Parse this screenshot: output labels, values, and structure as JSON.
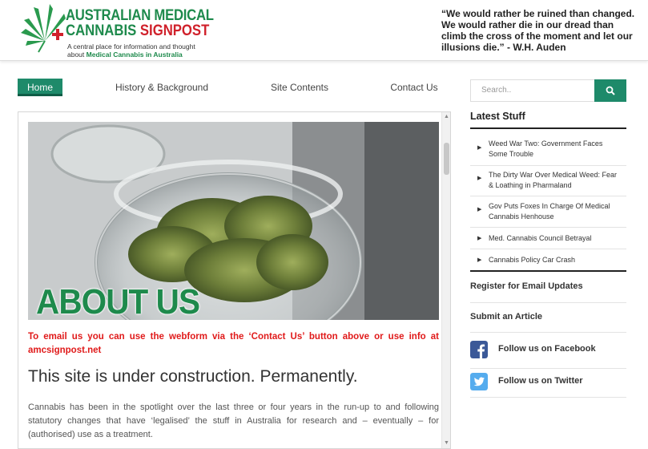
{
  "header": {
    "logo_line1": "AUSTRALIAN MEDICAL",
    "logo_line2_green": "CANNABIS",
    "logo_line2_red": "SIGNPOST",
    "tagline_line1": "A central place for information and thought",
    "tagline_line2_prefix": "about",
    "tagline_line2_bold": "Medical Cannabis in Australia",
    "quote": "“We would rather be ruined than changed. We would rather die in our dread than climb the cross of the moment and let our illusions die.” - W.H. Auden"
  },
  "nav": {
    "items": [
      {
        "label": "Home",
        "active": true
      },
      {
        "label": "History & Background",
        "active": false
      },
      {
        "label": "Site Contents",
        "active": false
      },
      {
        "label": "Contact Us",
        "active": false
      }
    ]
  },
  "main": {
    "hero_title": "ABOUT US",
    "email_note": "To email us you can use the webform via the ‘Contact Us’ button above or use info at amcsignpost.net",
    "headline": "This site is under construction. Permanently.",
    "paragraph": "Cannabis has been in the spotlight over the last three or four years in the run-up to and following statutory changes that have ‘legalised’ the stuff in Australia for research and – eventually – for (authorised) use as a treatment."
  },
  "sidebar": {
    "search_placeholder": "Search..",
    "latest_heading": "Latest Stuff",
    "posts": [
      "Weed War Two: Government Faces Some Trouble",
      "The Dirty War Over Medical Weed: Fear & Loathing in Pharmaland",
      "Gov Puts Foxes In Charge Of Medical Cannabis Henhouse",
      "Med. Cannabis Council Betrayal",
      "Cannabis Policy Car Crash"
    ],
    "register_label": "Register for Email Updates",
    "submit_label": "Submit an Article",
    "facebook_label": "Follow us on Facebook",
    "twitter_label": "Follow us on Twitter"
  },
  "colors": {
    "brand_green": "#1e8a4c",
    "nav_green": "#1e8a6a",
    "alert_red": "#e01a1a",
    "facebook_blue": "#3b5998",
    "twitter_blue": "#55acee"
  }
}
